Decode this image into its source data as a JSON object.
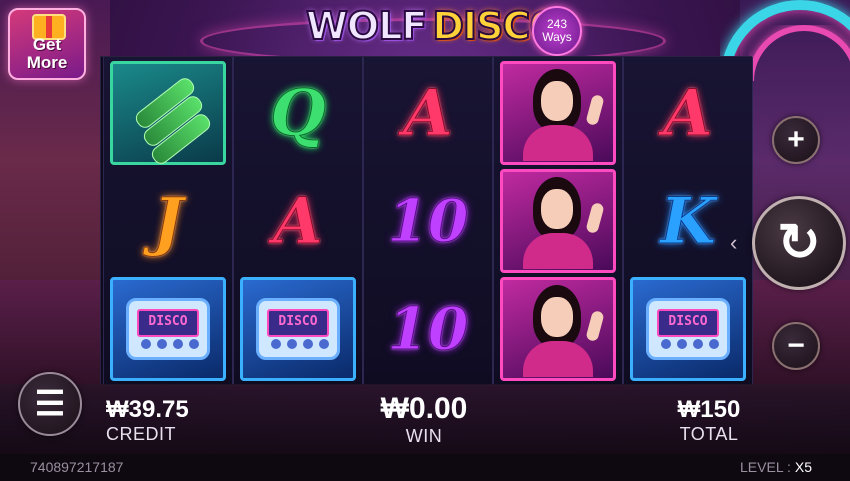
{
  "game": {
    "title_wolf": "WOLF",
    "title_disco": "DISCO",
    "ways_count": "243",
    "ways_label": "Ways"
  },
  "promo": {
    "label_line1": "Get",
    "label_line2": "More",
    "icon": "gift-icon"
  },
  "reels": [
    [
      {
        "symbol": "beer-bottles-icon",
        "type": "bottles",
        "framed": true,
        "frame_color": "#3ad6a0"
      },
      {
        "symbol": "J",
        "type": "letter",
        "color": "orange"
      },
      {
        "symbol": "DISCO",
        "type": "pager",
        "framed": true,
        "frame_color": "#3ab0ff"
      }
    ],
    [
      {
        "symbol": "Q",
        "type": "letter",
        "color": "green"
      },
      {
        "symbol": "A",
        "type": "letter",
        "color": "red"
      },
      {
        "symbol": "DISCO",
        "type": "pager",
        "framed": true,
        "frame_color": "#3ab0ff"
      }
    ],
    [
      {
        "symbol": "A",
        "type": "letter",
        "color": "red"
      },
      {
        "symbol": "10",
        "type": "letter",
        "color": "purple"
      },
      {
        "symbol": "10",
        "type": "letter",
        "color": "purple"
      }
    ],
    [
      {
        "symbol": "disco-lady-icon",
        "type": "lady",
        "framed": true,
        "frame_color": "#ff4ac0"
      },
      {
        "symbol": "disco-lady-icon",
        "type": "lady",
        "framed": true,
        "frame_color": "#ff4ac0"
      },
      {
        "symbol": "disco-lady-icon",
        "type": "lady",
        "framed": true,
        "frame_color": "#ff4ac0"
      }
    ],
    [
      {
        "symbol": "A",
        "type": "letter",
        "color": "red"
      },
      {
        "symbol": "K",
        "type": "letter",
        "color": "blue"
      },
      {
        "symbol": "DISCO",
        "type": "pager",
        "framed": true,
        "frame_color": "#3ab0ff"
      }
    ]
  ],
  "controls": {
    "plus": "+",
    "minus": "−",
    "spin_icon": "refresh-icon",
    "spin_glyph": "↻",
    "menu_icon": "hamburger-menu-icon",
    "menu_glyph": "☰",
    "spin_arrow": "‹"
  },
  "stats": {
    "credit_value": "₩39.75",
    "credit_label": "CREDIT",
    "win_value": "₩0.00",
    "win_label": "WIN",
    "total_value": "₩150",
    "total_label": "TOTAL"
  },
  "status": {
    "session_id": "740897217187",
    "level_label": "LEVEL :",
    "level_value": "X5"
  }
}
